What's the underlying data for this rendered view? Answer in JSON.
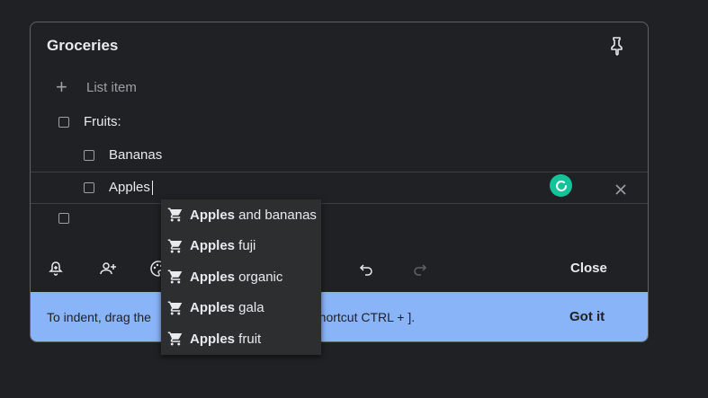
{
  "note": {
    "title": "Groceries",
    "add_placeholder": "List item",
    "items": [
      {
        "label": "Fruits:"
      },
      {
        "label": "Bananas"
      },
      {
        "label": "Apples"
      },
      {
        "label": ""
      }
    ]
  },
  "toolbar": {
    "close_label": "Close"
  },
  "tip": {
    "text_start": "To indent, drag the",
    "text_end": "e shortcut CTRL + ].",
    "got_it_label": "Got it"
  },
  "suggestions": [
    {
      "bold": "Apples",
      "rest": " and bananas"
    },
    {
      "bold": "Apples",
      "rest": " fuji"
    },
    {
      "bold": "Apples",
      "rest": " organic"
    },
    {
      "bold": "Apples",
      "rest": " gala"
    },
    {
      "bold": "Apples",
      "rest": " fruit"
    }
  ],
  "icons": {
    "pin": "pin-icon",
    "add": "plus-icon",
    "reminder": "bell-plus-icon",
    "collaborator": "person-add-icon",
    "color": "palette-icon",
    "undo": "undo-icon",
    "redo": "redo-icon",
    "delete": "close-icon",
    "suggestion": "shopping-cart-icon",
    "grammarly": "grammarly-icon"
  },
  "colors": {
    "background": "#202124",
    "tip_background": "#8ab4f8",
    "grammarly": "#15c39a"
  }
}
